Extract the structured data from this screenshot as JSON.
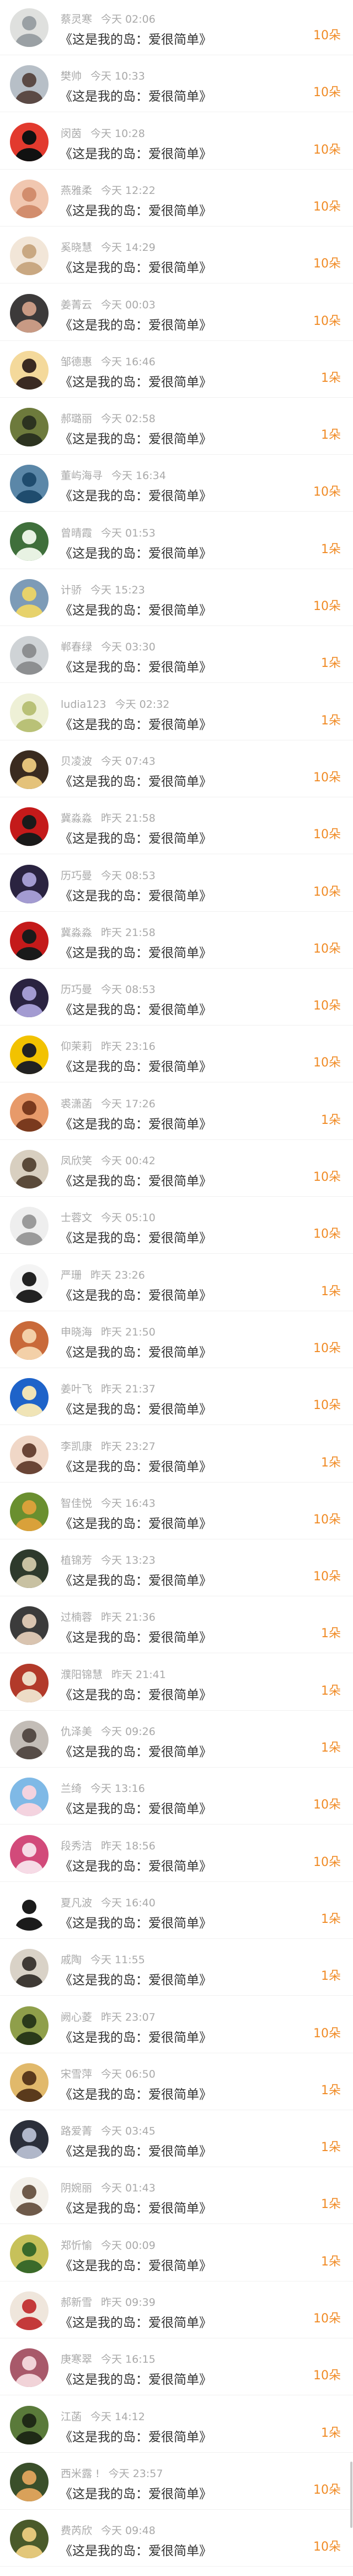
{
  "book_title": "《这是我的岛：爱很简单》",
  "accent_color": "#f08a24",
  "entries": [
    {
      "user": "蔡灵寒",
      "time": "今天 02:06",
      "flowers": "10朵",
      "avatar_colors": [
        "#dfe0de",
        "#9aa0a4"
      ]
    },
    {
      "user": "樊帅",
      "time": "今天 10:33",
      "flowers": "10朵",
      "avatar_colors": [
        "#b7bfc7",
        "#5b4a45"
      ]
    },
    {
      "user": "闵茵",
      "time": "今天 10:28",
      "flowers": "10朵",
      "avatar_colors": [
        "#e23a2e",
        "#111111"
      ]
    },
    {
      "user": "燕雅柔",
      "time": "今天 12:22",
      "flowers": "10朵",
      "avatar_colors": [
        "#f1c7b0",
        "#d28d6d"
      ]
    },
    {
      "user": "奚晓慧",
      "time": "今天 14:29",
      "flowers": "10朵",
      "avatar_colors": [
        "#f2e6d8",
        "#c9a882"
      ]
    },
    {
      "user": "姜菁云",
      "time": "今天 00:03",
      "flowers": "10朵",
      "avatar_colors": [
        "#3c3a3a",
        "#c89a84"
      ]
    },
    {
      "user": "邹德惠",
      "time": "今天 16:46",
      "flowers": "1朵",
      "avatar_colors": [
        "#f4d99b",
        "#3a2a22"
      ]
    },
    {
      "user": "郝璐丽",
      "time": "今天 02:58",
      "flowers": "1朵",
      "avatar_colors": [
        "#6d7a3c",
        "#2c3320"
      ]
    },
    {
      "user": "董屿海寻",
      "time": "今天 16:34",
      "flowers": "10朵",
      "avatar_colors": [
        "#5b87a8",
        "#1f4c6e"
      ]
    },
    {
      "user": "曾晴霞",
      "time": "今天 01:53",
      "flowers": "1朵",
      "avatar_colors": [
        "#3f6f3b",
        "#e8f2e3"
      ]
    },
    {
      "user": "计骄",
      "time": "今天 15:23",
      "flowers": "10朵",
      "avatar_colors": [
        "#7d9bb7",
        "#e7d26b"
      ]
    },
    {
      "user": "郸春绿",
      "time": "今天 03:30",
      "flowers": "1朵",
      "avatar_colors": [
        "#cfd3d6",
        "#8d8f91"
      ]
    },
    {
      "user": "ludia123",
      "time": "今天 02:32",
      "flowers": "1朵",
      "avatar_colors": [
        "#eef0d6",
        "#b9c177"
      ]
    },
    {
      "user": "贝凌波",
      "time": "今天 07:43",
      "flowers": "10朵",
      "avatar_colors": [
        "#3a2b1f",
        "#e4c27a"
      ]
    },
    {
      "user": "冀淼淼",
      "time": "昨天 21:58",
      "flowers": "10朵",
      "avatar_colors": [
        "#c41a1a",
        "#1a1a1a"
      ]
    },
    {
      "user": "历巧曼",
      "time": "今天 08:53",
      "flowers": "10朵",
      "avatar_colors": [
        "#2a2340",
        "#a39bd1"
      ]
    },
    {
      "user": "冀淼淼",
      "time": "昨天 21:58",
      "flowers": "10朵",
      "avatar_colors": [
        "#c41a1a",
        "#1a1a1a"
      ]
    },
    {
      "user": "历巧曼",
      "time": "今天 08:53",
      "flowers": "10朵",
      "avatar_colors": [
        "#2a2340",
        "#a39bd1"
      ]
    },
    {
      "user": "仰茉莉",
      "time": "昨天 23:16",
      "flowers": "10朵",
      "avatar_colors": [
        "#f2c200",
        "#222222"
      ]
    },
    {
      "user": "裘潇菡",
      "time": "今天 17:26",
      "flowers": "1朵",
      "avatar_colors": [
        "#e79a6a",
        "#7a3a1e"
      ]
    },
    {
      "user": "凤欣笑",
      "time": "今天 00:42",
      "flowers": "10朵",
      "avatar_colors": [
        "#d8cfc0",
        "#5a4a3a"
      ]
    },
    {
      "user": "士蓉文",
      "time": "今天 05:10",
      "flowers": "10朵",
      "avatar_colors": [
        "#eeeeee",
        "#9a9a9a"
      ]
    },
    {
      "user": "严珊",
      "time": "昨天 23:26",
      "flowers": "1朵",
      "avatar_colors": [
        "#f4f4f4",
        "#222222"
      ]
    },
    {
      "user": "申晓海",
      "time": "昨天 21:50",
      "flowers": "10朵",
      "avatar_colors": [
        "#c96a3a",
        "#f3d0a8"
      ]
    },
    {
      "user": "姜叶飞",
      "time": "昨天 21:37",
      "flowers": "10朵",
      "avatar_colors": [
        "#1e63c9",
        "#f0e4b6"
      ]
    },
    {
      "user": "李凯康",
      "time": "昨天 23:27",
      "flowers": "1朵",
      "avatar_colors": [
        "#f0d7c7",
        "#6a4536"
      ]
    },
    {
      "user": "智佳悦",
      "time": "今天 16:43",
      "flowers": "10朵",
      "avatar_colors": [
        "#6a8f2f",
        "#d9a13a"
      ]
    },
    {
      "user": "植锦芳",
      "time": "今天 13:23",
      "flowers": "10朵",
      "avatar_colors": [
        "#2e3a2c",
        "#c8c1a2"
      ]
    },
    {
      "user": "过楠蓉",
      "time": "昨天 21:36",
      "flowers": "1朵",
      "avatar_colors": [
        "#3b3b3b",
        "#d9c4b0"
      ]
    },
    {
      "user": "濮阳锦慧",
      "time": "昨天 21:41",
      "flowers": "1朵",
      "avatar_colors": [
        "#b23a2a",
        "#eddcc6"
      ]
    },
    {
      "user": "仇泽美",
      "time": "今天 09:26",
      "flowers": "1朵",
      "avatar_colors": [
        "#c3bdb7",
        "#564c47"
      ]
    },
    {
      "user": "兰绮",
      "time": "今天 13:16",
      "flowers": "10朵",
      "avatar_colors": [
        "#7fb9e6",
        "#f4d3df"
      ]
    },
    {
      "user": "段秀洁",
      "time": "昨天 18:56",
      "flowers": "10朵",
      "avatar_colors": [
        "#d24a7a",
        "#f6dbe6"
      ]
    },
    {
      "user": "夏凡波",
      "time": "今天 16:40",
      "flowers": "1朵",
      "avatar_colors": [
        "#ffffff",
        "#1b1b1b"
      ]
    },
    {
      "user": "戚陶",
      "time": "今天 11:55",
      "flowers": "1朵",
      "avatar_colors": [
        "#d9d2c7",
        "#3f3a35"
      ]
    },
    {
      "user": "阙心菱",
      "time": "昨天 23:07",
      "flowers": "10朵",
      "avatar_colors": [
        "#8f9f4a",
        "#2a3a1a"
      ]
    },
    {
      "user": "宋雪萍",
      "time": "今天 06:50",
      "flowers": "1朵",
      "avatar_colors": [
        "#e1b96b",
        "#5a3a1c"
      ]
    },
    {
      "user": "路爱菁",
      "time": "今天 03:45",
      "flowers": "1朵",
      "avatar_colors": [
        "#2b2f3a",
        "#b0b7c9"
      ]
    },
    {
      "user": "阴婉丽",
      "time": "今天 01:43",
      "flowers": "1朵",
      "avatar_colors": [
        "#f3f0ea",
        "#6e5a4a"
      ]
    },
    {
      "user": "郑忻愉",
      "time": "今天 00:09",
      "flowers": "1朵",
      "avatar_colors": [
        "#c7c15a",
        "#3a6a2a"
      ]
    },
    {
      "user": "郝新雪",
      "time": "昨天 09:39",
      "flowers": "10朵",
      "avatar_colors": [
        "#efe6dc",
        "#c43a3a"
      ]
    },
    {
      "user": "庚寒翠",
      "time": "今天 16:15",
      "flowers": "10朵",
      "avatar_colors": [
        "#a8596a",
        "#f1d3d8"
      ]
    },
    {
      "user": "江菡",
      "time": "今天 14:12",
      "flowers": "1朵",
      "avatar_colors": [
        "#5a7a3a",
        "#1f2a16"
      ]
    },
    {
      "user": "西米露 !",
      "time": "今天 23:57",
      "flowers": "10朵",
      "avatar_colors": [
        "#3a4f2a",
        "#d9a15a"
      ]
    },
    {
      "user": "费芮欣",
      "time": "今天 09:48",
      "flowers": "10朵",
      "avatar_colors": [
        "#4a5a2a",
        "#e3c77a"
      ]
    }
  ]
}
